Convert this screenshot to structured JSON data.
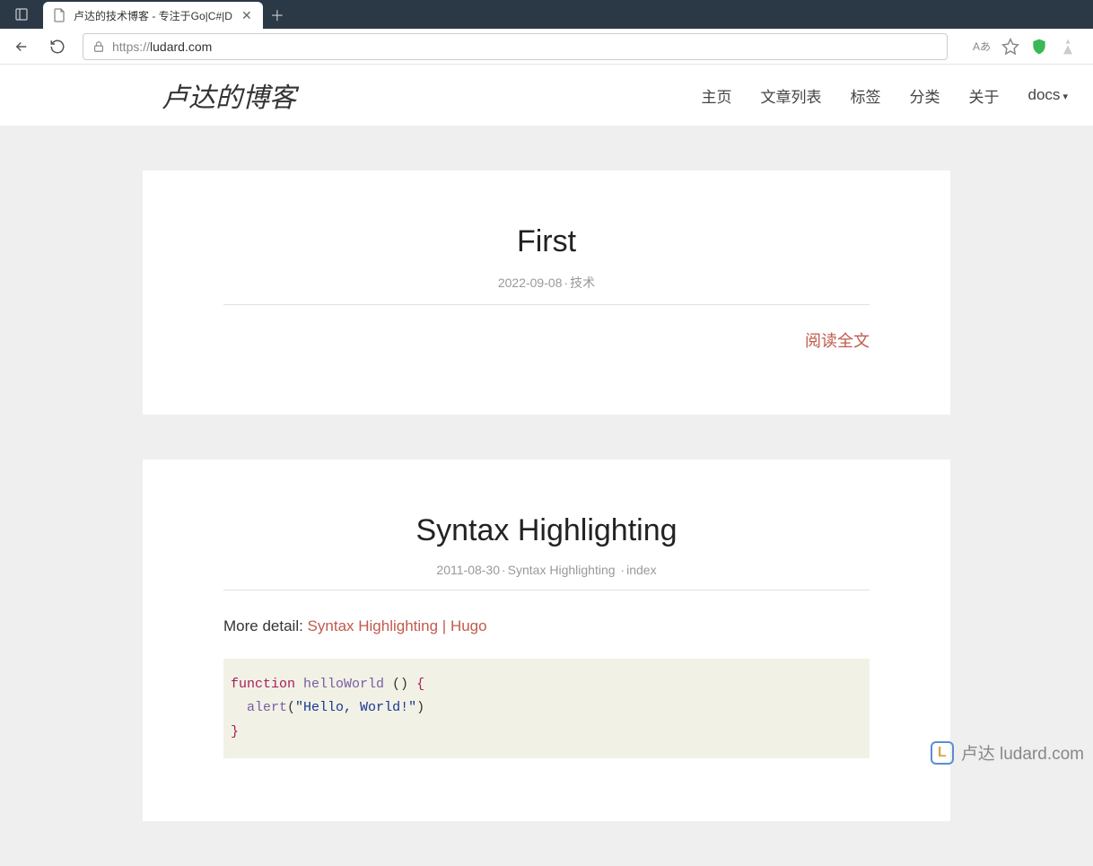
{
  "browser": {
    "tab_title": "卢达的技术博客 - 专注于Go|C#|D",
    "url_proto": "https://",
    "url_domain": "ludard.com",
    "translate_badge": "Aあ"
  },
  "site": {
    "title": "卢达的博客",
    "nav": {
      "home": "主页",
      "posts": "文章列表",
      "tags": "标签",
      "categories": "分类",
      "about": "关于",
      "docs": "docs"
    }
  },
  "posts": [
    {
      "title": "First",
      "date": "2022-09-08",
      "category": "技术",
      "read_more": "阅读全文"
    },
    {
      "title": "Syntax Highlighting",
      "date": "2011-08-30",
      "category": "Syntax Highlighting",
      "tag": "index",
      "content_prefix": "More detail: ",
      "content_link": "Syntax Highlighting | Hugo",
      "code": {
        "kw_function": "function",
        "fn_name": "helloWorld",
        "parens": " () ",
        "brace_open": "{",
        "fn_alert": "alert",
        "paren_open": "(",
        "str": "\"Hello, World!\"",
        "paren_close": ")",
        "brace_close": "}"
      }
    }
  ],
  "watermark": {
    "logo_letter": "L",
    "text": "卢达 ludard.com"
  }
}
